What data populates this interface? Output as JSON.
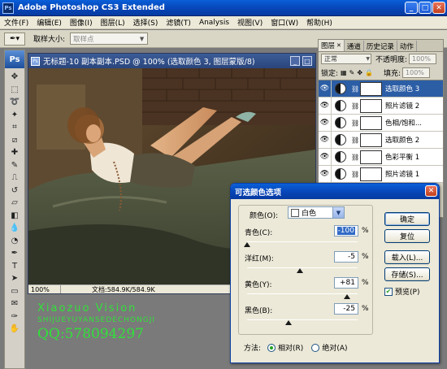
{
  "window": {
    "title": "Adobe Photoshop CS3 Extended",
    "colors": {
      "titlebar": "#0745b8",
      "workspace": "#7a7a7a"
    }
  },
  "menubar": {
    "items": [
      "文件(F)",
      "编辑(E)",
      "图像(I)",
      "图层(L)",
      "选择(S)",
      "滤镜(T)",
      "Analysis",
      "视图(V)",
      "窗口(W)",
      "帮助(H)"
    ]
  },
  "options_bar": {
    "label": "取样大小:",
    "select_value": "取样点"
  },
  "toolbox": {
    "logo": "Ps"
  },
  "document": {
    "title": "无标题-10 副本副本.PSD @ 100% (选取颜色 3, 图层蒙版/8)",
    "zoom": "100%",
    "doc_size": "文档:584.9K/584.9K"
  },
  "watermark": {
    "line1": "Xiaozuo Vision",
    "line2": "SHIJUEYUYANSEDECHONGJI",
    "line3": "QQ:578094297"
  },
  "layers_panel": {
    "tabs": [
      "图层",
      "通道",
      "历史记录",
      "动作"
    ],
    "blend_mode": "正常",
    "opacity_label": "不透明度:",
    "opacity_value": "100%",
    "lock_label": "锁定:",
    "fill_label": "填充:",
    "fill_value": "100%",
    "layers": [
      {
        "name": "选取颜色 3",
        "active": true
      },
      {
        "name": "照片滤镜 2",
        "active": false
      },
      {
        "name": "色相/饱和...",
        "active": false
      },
      {
        "name": "选取颜色 2",
        "active": false
      },
      {
        "name": "色彩平衡 1",
        "active": false
      },
      {
        "name": "照片滤镜 1",
        "active": false
      }
    ]
  },
  "dialog": {
    "title": "可选颜色选项",
    "colors_label": "颜色(O):",
    "colors_value": "白色",
    "sliders": [
      {
        "label": "青色(C):",
        "value": "-100",
        "position": 0.0
      },
      {
        "label": "洋红(M):",
        "value": "-5",
        "position": 0.475
      },
      {
        "label": "黄色(Y):",
        "value": "+81",
        "position": 0.905
      },
      {
        "label": "黑色(B):",
        "value": "-25",
        "position": 0.375
      }
    ],
    "percent": "%",
    "buttons": {
      "ok": "确定",
      "reset": "复位",
      "load": "载入(L)...",
      "save": "存储(S)..."
    },
    "preview_label": "预览(P)",
    "method_label": "方法:",
    "method_relative": "相对(R)",
    "method_absolute": "绝对(A)"
  }
}
